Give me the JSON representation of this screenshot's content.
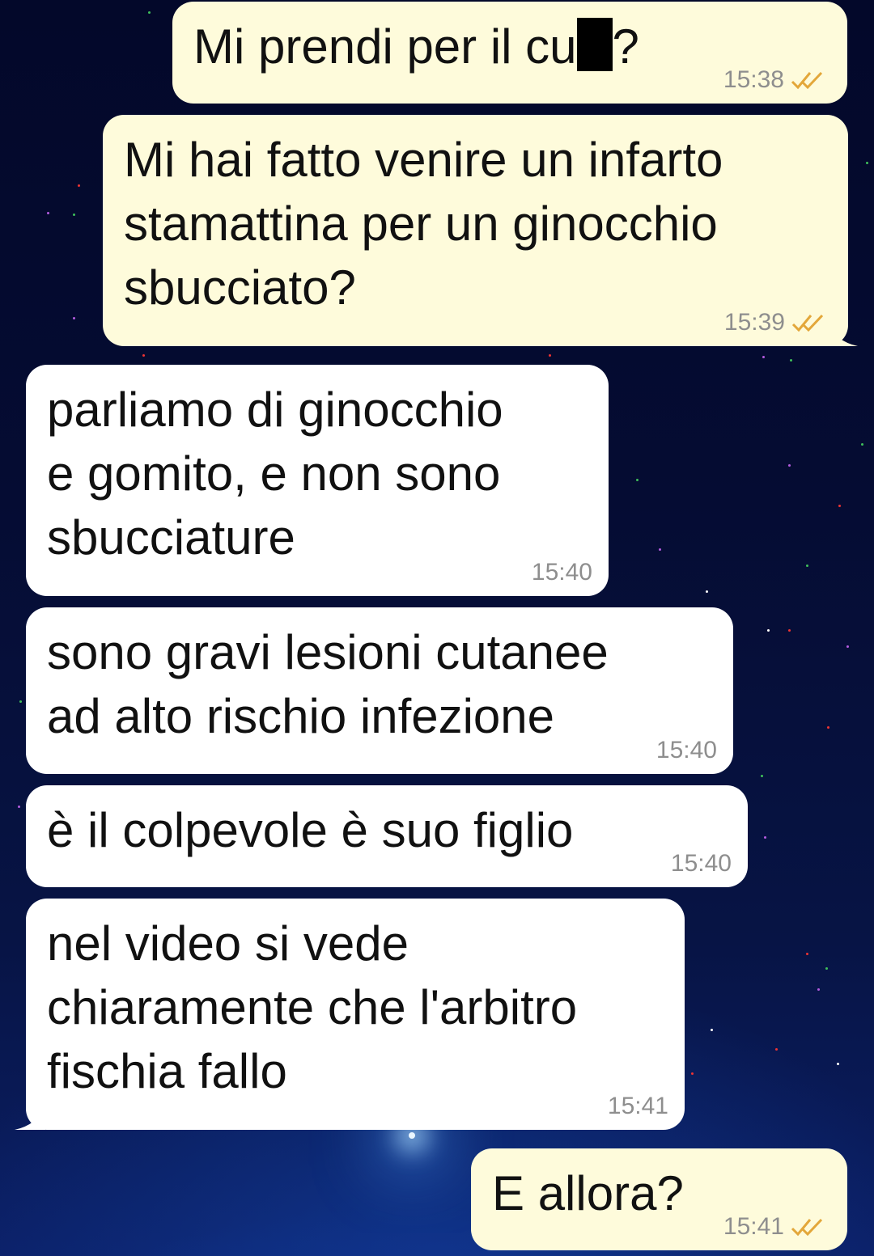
{
  "messages": [
    {
      "direction": "out",
      "text_before": "Mi prendi per il cu",
      "text_after": "?",
      "time": "15:38",
      "read": true
    },
    {
      "direction": "out",
      "text": "Mi hai fatto venire un infarto\nstamattina per un ginocchio\nsbucciato?",
      "time": "15:39",
      "read": true
    },
    {
      "direction": "in",
      "text": "parliamo di ginocchio\ne gomito, e non sono\nsbucciature",
      "time": "15:40"
    },
    {
      "direction": "in",
      "text": "sono gravi lesioni cutanee\nad alto rischio infezione",
      "time": "15:40"
    },
    {
      "direction": "in",
      "text": "è il colpevole è suo figlio",
      "time": "15:40"
    },
    {
      "direction": "in",
      "text": "nel video si vede\nchiaramente che l'arbitro\nfischia fallo",
      "time": "15:41"
    },
    {
      "direction": "out",
      "text": "E allora?",
      "time": "15:41",
      "read": true
    }
  ],
  "colors": {
    "outgoing_bubble": "#fefbdb",
    "incoming_bubble": "#ffffff",
    "read_ticks": "#e3a73a",
    "timestamp": "#8e8e8e",
    "background": "#050c33"
  },
  "icons": {
    "read_receipt": "double-check-icon"
  }
}
